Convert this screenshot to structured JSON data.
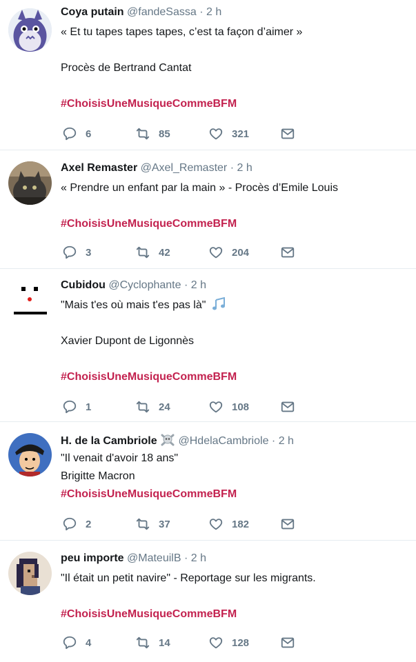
{
  "colors": {
    "name": "#14171a",
    "meta": "#657786",
    "hashtag": "#c3224f",
    "divider": "#e6ecf0"
  },
  "tweets": [
    {
      "name": "Coya putain",
      "handle": "@fandeSassa",
      "separator": "·",
      "time": "2 h",
      "avatar_icon": "totoro-avatar",
      "lines": [
        "« Et tu tapes tapes tapes, c’est ta façon d’aimer »",
        "",
        "Procès de Bertrand Cantat",
        ""
      ],
      "hashtag": "#ChoisisUneMusiqueCommeBFM",
      "replies": "6",
      "retweets": "85",
      "likes": "321"
    },
    {
      "name": "Axel Remaster",
      "handle": "@Axel_Remaster",
      "separator": "·",
      "time": "2 h",
      "avatar_icon": "cat-photo-avatar",
      "lines": [
        "« Prendre un enfant par la main » - Procès d’Emile Louis",
        ""
      ],
      "hashtag": "#ChoisisUneMusiqueCommeBFM",
      "replies": "3",
      "retweets": "42",
      "likes": "204"
    },
    {
      "name": "Cubidou",
      "handle": "@Cyclophante",
      "separator": "·",
      "time": "2 h",
      "avatar_icon": "face-avatar",
      "lines": [
        "\"Mais t'es où mais t'es pas là\"",
        "",
        "Xavier Dupont de Ligonnès",
        ""
      ],
      "emoji": "music-notes-icon",
      "hashtag": "#ChoisisUneMusiqueCommeBFM",
      "replies": "1",
      "retweets": "24",
      "likes": "108"
    },
    {
      "name": "H. de la Cambriole",
      "handle": "@HdelaCambriole",
      "separator": "·",
      "time": "2 h",
      "avatar_icon": "cartoon-thief-avatar",
      "name_emoji": "skull-crossbones-icon",
      "lines": [
        "\"Il venait d'avoir 18 ans\"",
        "Brigitte Macron"
      ],
      "hashtag": "#ChoisisUneMusiqueCommeBFM",
      "replies": "2",
      "retweets": "37",
      "likes": "182"
    },
    {
      "name": "peu importe",
      "handle": "@MateuilB",
      "separator": "·",
      "time": "2 h",
      "avatar_icon": "pixel-art-avatar",
      "lines": [
        "\"Il était un petit navire\" - Reportage sur les migrants.",
        ""
      ],
      "hashtag": "#ChoisisUneMusiqueCommeBFM",
      "replies": "4",
      "retweets": "14",
      "likes": "128"
    }
  ]
}
